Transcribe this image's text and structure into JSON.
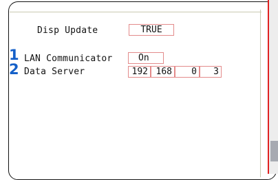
{
  "settings": {
    "disp_update": {
      "label": "Disp Update",
      "value": "TRUE"
    },
    "lan_communicator": {
      "marker": "1",
      "label": "LAN Communicator",
      "value": "On"
    },
    "data_server": {
      "marker": "2",
      "label": "Data Server",
      "ip": [
        "192",
        "168",
        "0",
        "3"
      ]
    }
  },
  "colors": {
    "field_border": "#e38a8a",
    "marker": "#1560c8",
    "edge_red": "#e02020"
  }
}
